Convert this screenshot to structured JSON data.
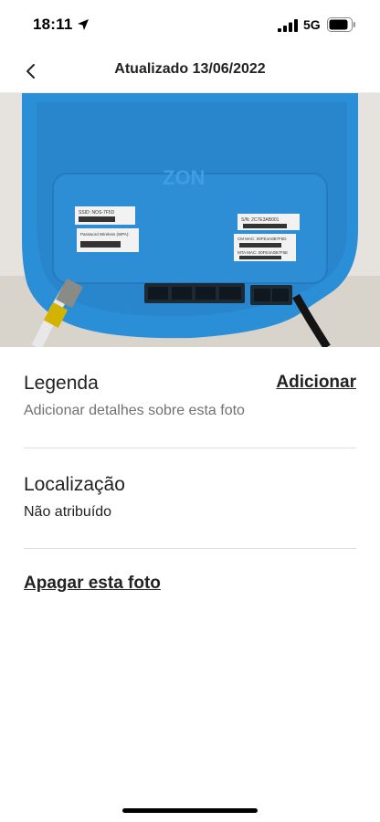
{
  "status_bar": {
    "time": "18:11",
    "network": "5G",
    "location_icon": "location-arrow-icon",
    "signal_icon": "cellular-signal-icon",
    "battery_icon": "battery-icon"
  },
  "header": {
    "title": "Atualizado 13/06/2022",
    "back_icon": "chevron-left-icon"
  },
  "photo": {
    "edit_icon": "pencil-icon",
    "router_brand": "ZON",
    "labels": {
      "ssid": "SSID: NOS-7F5D",
      "password": "Password Wireless (WPA):",
      "sn": "S/N: 2C7E3AB001",
      "cm_mac": "CM MAC: 00FE4A0B7F5D",
      "mta_mac": "MTA MAC: 00FE4A0B7F5E"
    }
  },
  "legenda": {
    "title": "Legenda",
    "placeholder": "Adicionar detalhes sobre esta foto",
    "action": "Adicionar"
  },
  "localizacao": {
    "title": "Localização",
    "value": "Não atribuído"
  },
  "delete": {
    "label": "Apagar esta foto"
  },
  "colors": {
    "text_primary": "#222222",
    "text_secondary": "#717171",
    "divider": "#dddddd",
    "router_blue": "#2b8fd8"
  }
}
